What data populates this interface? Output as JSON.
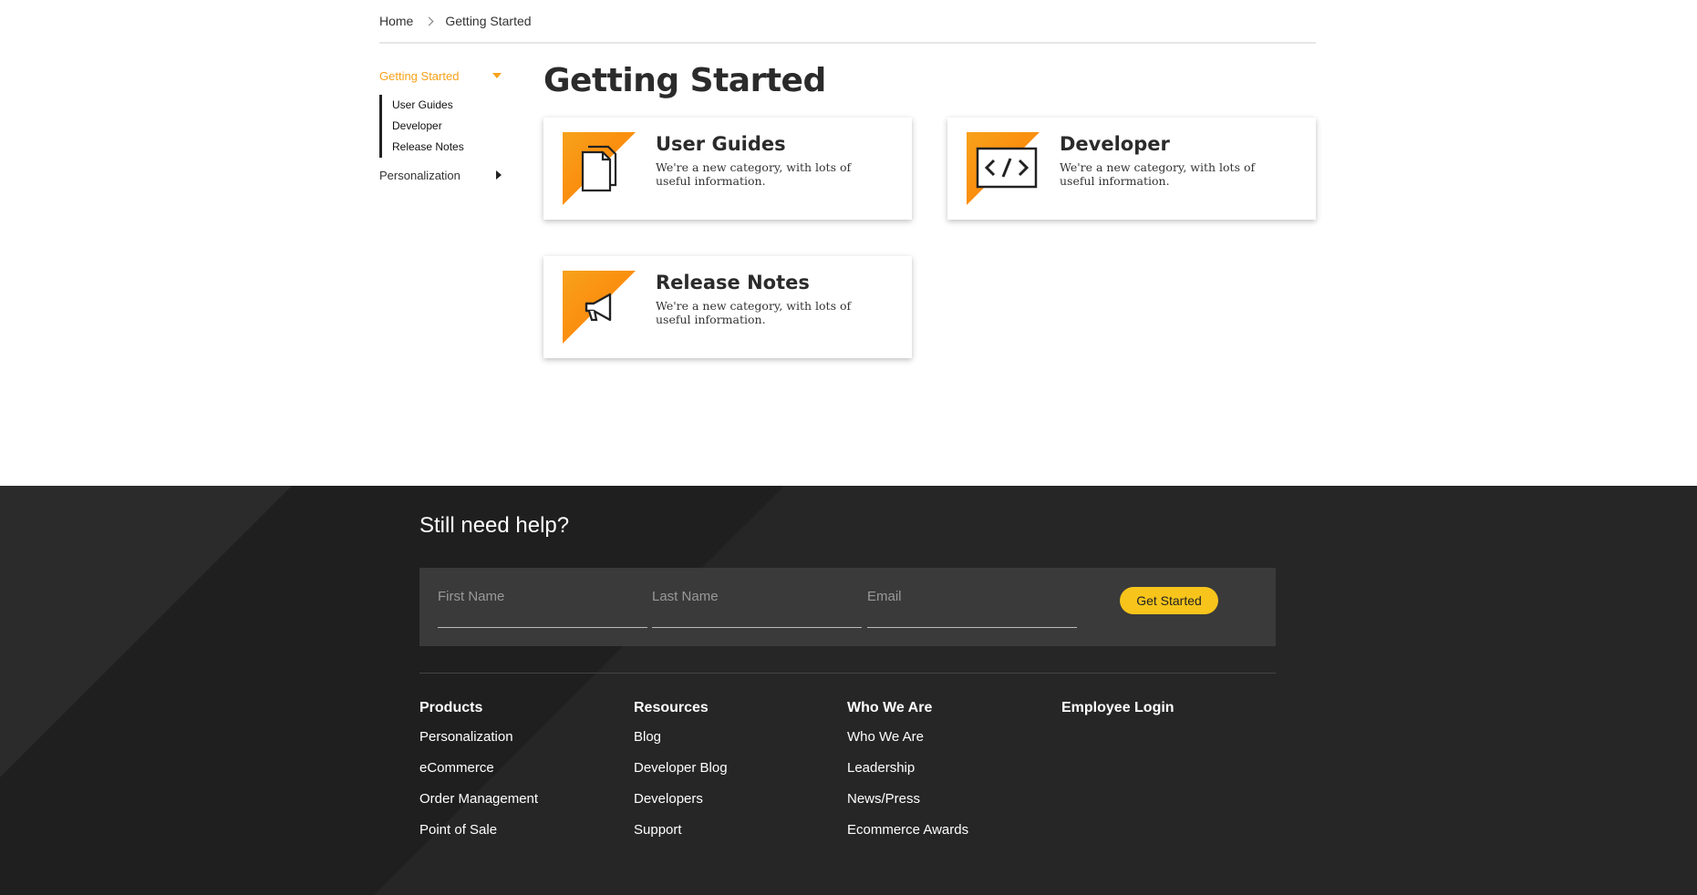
{
  "breadcrumb": {
    "home": "Home",
    "current": "Getting Started"
  },
  "sidebar": {
    "active_label": "Getting Started",
    "sub_items": [
      "User Guides",
      "Developer",
      "Release Notes"
    ],
    "other_label": "Personalization"
  },
  "main": {
    "title": "Getting Started",
    "cards": [
      {
        "title": "User Guides",
        "desc": "We're a new category, with lots of useful information.",
        "icon": "documents-icon"
      },
      {
        "title": "Developer",
        "desc": "We're a new category, with lots of useful information.",
        "icon": "code-icon"
      },
      {
        "title": "Release Notes",
        "desc": "We're a new category, with lots of useful information.",
        "icon": "megaphone-icon"
      }
    ]
  },
  "footer": {
    "help_title": "Still need help?",
    "form": {
      "first_name_placeholder": "First Name",
      "last_name_placeholder": "Last Name",
      "email_placeholder": "Email",
      "submit_label": "Get Started"
    },
    "columns": [
      {
        "heading": "Products",
        "links": [
          "Personalization",
          "eCommerce",
          "Order Management",
          "Point of Sale"
        ]
      },
      {
        "heading": "Resources",
        "links": [
          "Blog",
          "Developer Blog",
          "Developers",
          "Support"
        ]
      },
      {
        "heading": "Who We Are",
        "links": [
          "Who We Are",
          "Leadership",
          "News/Press",
          "Ecommerce Awards"
        ]
      },
      {
        "heading": "Employee Login",
        "links": []
      }
    ]
  },
  "colors": {
    "accent": "#f7a21b",
    "button": "#f7c41b",
    "footer_bg": "#262626"
  }
}
